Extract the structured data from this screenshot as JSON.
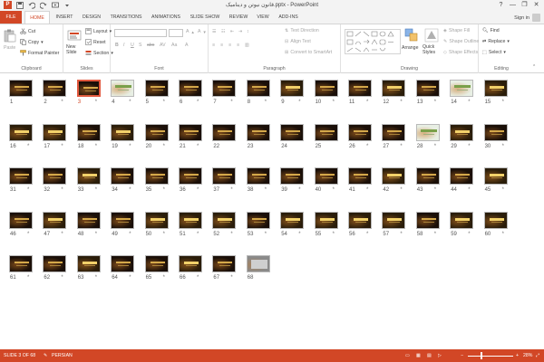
{
  "window": {
    "title": "قانون نیوتن و دینامیک.pptx - PowerPoint",
    "help": "?",
    "minimize": "—",
    "restore": "❐",
    "close": "✕",
    "signin": "Sign in"
  },
  "quick_access": [
    "save-icon",
    "undo-icon",
    "redo-icon",
    "start-from-beginning-icon",
    "customize-icon"
  ],
  "tabs": [
    {
      "label": "FILE"
    },
    {
      "label": "HOME"
    },
    {
      "label": "INSERT"
    },
    {
      "label": "DESIGN"
    },
    {
      "label": "TRANSITIONS"
    },
    {
      "label": "ANIMATIONS"
    },
    {
      "label": "SLIDE SHOW"
    },
    {
      "label": "REVIEW"
    },
    {
      "label": "VIEW"
    },
    {
      "label": "ADD-INS"
    }
  ],
  "ribbon": {
    "clipboard": {
      "label": "Clipboard",
      "paste": "Paste",
      "cut": "Cut",
      "copy": "Copy",
      "format_painter": "Format Painter"
    },
    "slides": {
      "label": "Slides",
      "new_slide": "New Slide",
      "layout": "Layout",
      "reset": "Reset",
      "section": "Section"
    },
    "font": {
      "label": "Font",
      "font_name": "",
      "font_size": ""
    },
    "paragraph": {
      "label": "Paragraph",
      "text_direction": "Text Direction",
      "align_text": "Align Text",
      "convert_smartart": "Convert to SmartArt"
    },
    "drawing": {
      "label": "Drawing",
      "arrange": "Arrange",
      "quick_styles": "Quick Styles",
      "shape_fill": "Shape Fill",
      "shape_outline": "Shape Outline",
      "shape_effects": "Shape Effects"
    },
    "editing": {
      "label": "Editing",
      "find": "Find",
      "replace": "Replace",
      "select": "Select"
    }
  },
  "slides": [
    {
      "n": "1",
      "style": "dark",
      "star": ""
    },
    {
      "n": "2",
      "style": "dark",
      "star": "*"
    },
    {
      "n": "3",
      "style": "dark",
      "star": "*",
      "selected": true
    },
    {
      "n": "4",
      "style": "light",
      "star": "*"
    },
    {
      "n": "5",
      "style": "dark",
      "star": "*"
    },
    {
      "n": "6",
      "style": "dark",
      "star": "*"
    },
    {
      "n": "7",
      "style": "dark",
      "star": "*"
    },
    {
      "n": "8",
      "style": "dark",
      "star": "*"
    },
    {
      "n": "9",
      "style": "yellow",
      "star": "*"
    },
    {
      "n": "10",
      "style": "dark",
      "star": "*"
    },
    {
      "n": "11",
      "style": "dark",
      "star": "*"
    },
    {
      "n": "12",
      "style": "yellow",
      "star": "*"
    },
    {
      "n": "13",
      "style": "dark",
      "star": "*"
    },
    {
      "n": "14",
      "style": "light",
      "star": "*"
    },
    {
      "n": "15",
      "style": "yellow",
      "star": "*"
    },
    {
      "n": "16",
      "style": "yellow",
      "star": "*"
    },
    {
      "n": "17",
      "style": "yellow",
      "star": "*"
    },
    {
      "n": "18",
      "style": "dark",
      "star": "*"
    },
    {
      "n": "19",
      "style": "yellow",
      "star": "*"
    },
    {
      "n": "20",
      "style": "dark",
      "star": "*"
    },
    {
      "n": "21",
      "style": "dark",
      "star": "*"
    },
    {
      "n": "22",
      "style": "dark",
      "star": ""
    },
    {
      "n": "23",
      "style": "dark",
      "star": ""
    },
    {
      "n": "24",
      "style": "dark",
      "star": ""
    },
    {
      "n": "25",
      "style": "dark",
      "star": ""
    },
    {
      "n": "26",
      "style": "dark",
      "star": "*"
    },
    {
      "n": "27",
      "style": "dark",
      "star": "*"
    },
    {
      "n": "28",
      "style": "light",
      "star": "*"
    },
    {
      "n": "29",
      "style": "yellow",
      "star": "*"
    },
    {
      "n": "30",
      "style": "dark",
      "star": "*"
    },
    {
      "n": "31",
      "style": "dark",
      "star": "*"
    },
    {
      "n": "32",
      "style": "dark",
      "star": "*"
    },
    {
      "n": "33",
      "style": "yellow",
      "star": "*"
    },
    {
      "n": "34",
      "style": "dark",
      "star": "*"
    },
    {
      "n": "35",
      "style": "dark",
      "star": "*"
    },
    {
      "n": "36",
      "style": "dark",
      "star": "*"
    },
    {
      "n": "37",
      "style": "dark",
      "star": "*"
    },
    {
      "n": "38",
      "style": "dark",
      "star": "*"
    },
    {
      "n": "39",
      "style": "dark",
      "star": "*"
    },
    {
      "n": "40",
      "style": "dark",
      "star": "*"
    },
    {
      "n": "41",
      "style": "dark",
      "star": "*"
    },
    {
      "n": "42",
      "style": "yellow",
      "star": "*"
    },
    {
      "n": "43",
      "style": "dark",
      "star": "*"
    },
    {
      "n": "44",
      "style": "dark",
      "star": "*"
    },
    {
      "n": "45",
      "style": "yellow",
      "star": "*"
    },
    {
      "n": "46",
      "style": "dark",
      "star": "*"
    },
    {
      "n": "47",
      "style": "yellow",
      "star": "*"
    },
    {
      "n": "48",
      "style": "dark",
      "star": "*"
    },
    {
      "n": "49",
      "style": "dark",
      "star": "*"
    },
    {
      "n": "50",
      "style": "yellow",
      "star": "*"
    },
    {
      "n": "51",
      "style": "yellow",
      "star": "*"
    },
    {
      "n": "52",
      "style": "yellow",
      "star": "*"
    },
    {
      "n": "53",
      "style": "dark",
      "star": "*"
    },
    {
      "n": "54",
      "style": "yellow",
      "star": "*"
    },
    {
      "n": "55",
      "style": "yellow",
      "star": "*"
    },
    {
      "n": "56",
      "style": "yellow",
      "star": "*"
    },
    {
      "n": "57",
      "style": "yellow",
      "star": "*"
    },
    {
      "n": "58",
      "style": "dark",
      "star": "*"
    },
    {
      "n": "59",
      "style": "yellow",
      "star": "*"
    },
    {
      "n": "60",
      "style": "yellow",
      "star": "*"
    },
    {
      "n": "61",
      "style": "dark",
      "star": "*"
    },
    {
      "n": "62",
      "style": "dark",
      "star": "*"
    },
    {
      "n": "63",
      "style": "yellow",
      "star": "*"
    },
    {
      "n": "64",
      "style": "dark",
      "star": "*"
    },
    {
      "n": "65",
      "style": "dark",
      "star": "*"
    },
    {
      "n": "66",
      "style": "yellow",
      "star": "*"
    },
    {
      "n": "67",
      "style": "dark",
      "star": "*"
    },
    {
      "n": "68",
      "style": "photo",
      "star": ""
    }
  ],
  "status": {
    "slide_info": "SLIDE 3 OF 68",
    "language": "PERSIAN",
    "zoom": "28%",
    "zoom_level": 0.28
  },
  "colors": {
    "accent": "#d24726",
    "selection": "#e2583e"
  }
}
